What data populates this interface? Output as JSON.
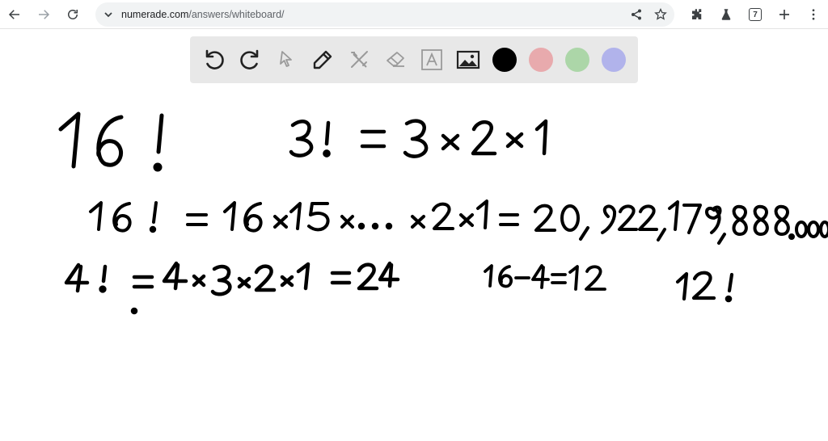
{
  "browser": {
    "url_host": "numerade.com",
    "url_path": "/answers/whiteboard/",
    "tab_count": "7"
  },
  "toolbar": {
    "tools": [
      "undo",
      "redo",
      "select",
      "pen",
      "tools",
      "eraser",
      "text",
      "image"
    ],
    "colors": [
      "#000000",
      "#e8aaad",
      "#acd6a8",
      "#b1b3eb"
    ]
  },
  "board": {
    "ink_color": "#000000"
  }
}
